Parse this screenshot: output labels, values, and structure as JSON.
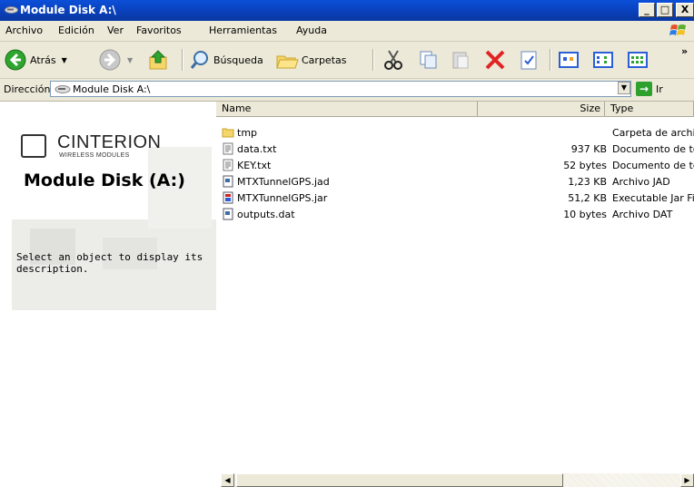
{
  "window": {
    "title": "Module Disk A:\\",
    "min_label": "_",
    "max_label": "□",
    "close_label": "X"
  },
  "menu": [
    "Archivo",
    "Edición",
    "Ver",
    "Favoritos",
    "Herramientas",
    "Ayuda"
  ],
  "toolbar": {
    "back_label": "Atrás",
    "search_label": "Búsqueda",
    "folders_label": "Carpetas",
    "more_label": "»"
  },
  "address": {
    "label": "Dirección",
    "value": "Module Disk A:\\",
    "go_label": "Ir"
  },
  "left_pane": {
    "brand": "CINTERION",
    "brand_sub": "WIRELESS MODULES",
    "title": "Module Disk (A:)",
    "message": "Select an object to display its description."
  },
  "columns": {
    "name": "Name",
    "size": "Size",
    "type": "Type"
  },
  "files": [
    {
      "name": "tmp",
      "size": "",
      "type": "Carpeta de archivos",
      "icon": "folder-icon"
    },
    {
      "name": "data.txt",
      "size": "937 KB",
      "type": "Documento de texto",
      "icon": "text-file-icon"
    },
    {
      "name": "KEY.txt",
      "size": "52 bytes",
      "type": "Documento de texto",
      "icon": "text-file-icon"
    },
    {
      "name": "MTXTunnelGPS.jad",
      "size": "1,23 KB",
      "type": "Archivo JAD",
      "icon": "generic-file-icon"
    },
    {
      "name": "MTXTunnelGPS.jar",
      "size": "51,2 KB",
      "type": "Executable Jar File",
      "icon": "jar-file-icon"
    },
    {
      "name": "outputs.dat",
      "size": "10 bytes",
      "type": "Archivo DAT",
      "icon": "generic-file-icon"
    }
  ],
  "colors": {
    "title_bar": "#0a3fb8",
    "chrome": "#ece9d8",
    "folder": "#f5d66a"
  }
}
